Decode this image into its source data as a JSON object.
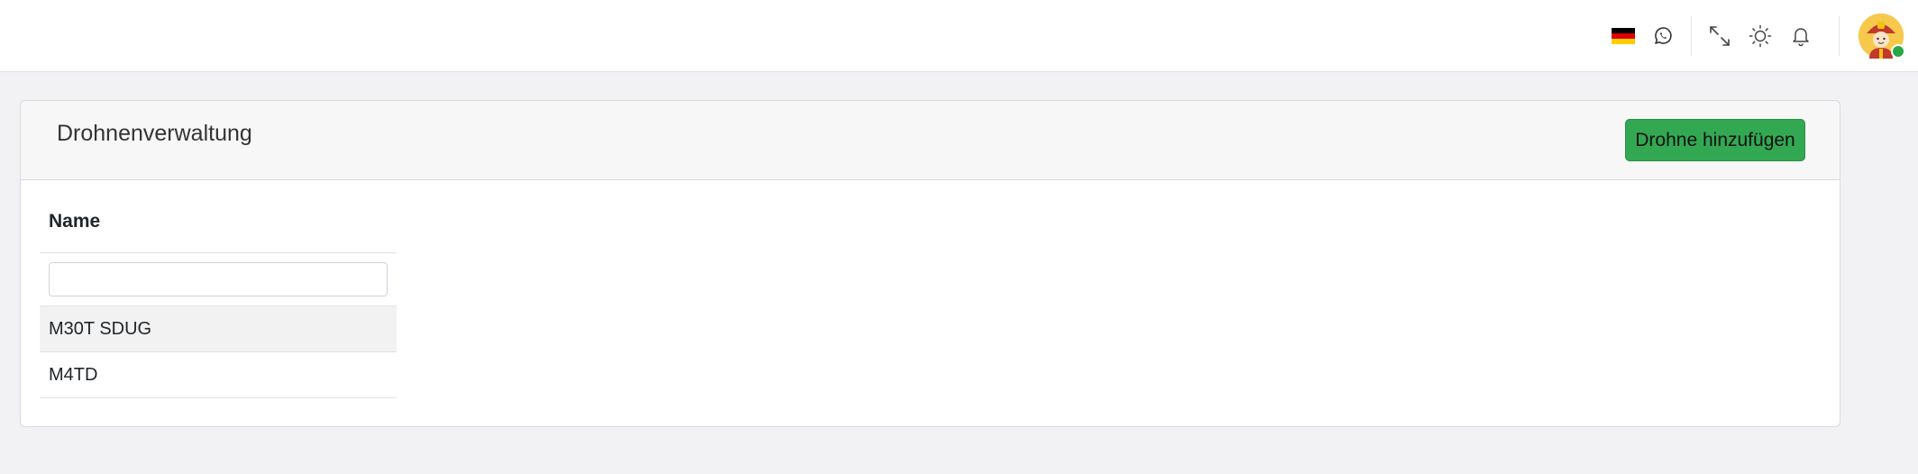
{
  "topbar": {
    "icons": [
      {
        "name": "german-flag-icon"
      },
      {
        "name": "whatsapp-icon"
      },
      {
        "name": "fullscreen-icon"
      },
      {
        "name": "theme-sun-icon"
      },
      {
        "name": "bell-icon"
      }
    ],
    "avatar": {
      "name": "firefighter-avatar",
      "status_color": "#28a745"
    }
  },
  "card": {
    "title": "Drohnenverwaltung",
    "add_button_label": "Drohne hinzufügen"
  },
  "table": {
    "header_name": "Name",
    "filter_value": "",
    "rows": [
      {
        "name": "M30T SDUG"
      },
      {
        "name": "M4TD"
      }
    ]
  },
  "colors": {
    "accent_green": "#33a852",
    "background": "#f2f2f5"
  }
}
